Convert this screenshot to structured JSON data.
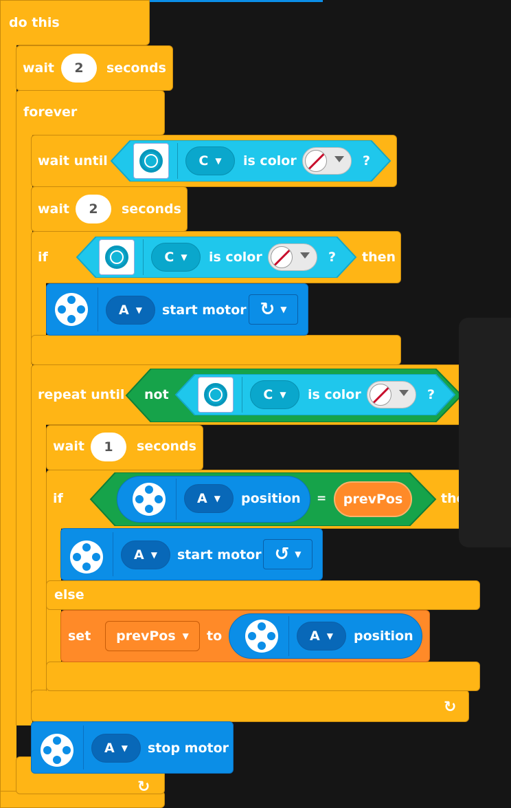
{
  "labels": {
    "do_this": "do this",
    "wait": "wait",
    "seconds": "seconds",
    "forever": "forever",
    "wait_until": "wait until",
    "is_color": "is color",
    "question": "?",
    "if": "if",
    "then": "then",
    "start_motor": "start motor",
    "repeat_until": "repeat until",
    "not": "not",
    "position": "position",
    "equals": "=",
    "else": "else",
    "set": "set",
    "to": "to",
    "stop_motor": "stop motor"
  },
  "values": {
    "wait1": "2",
    "wait2": "2",
    "wait3": "1",
    "port_c": "C",
    "port_a": "A",
    "variable": "prevPos",
    "variable_dropdown": "prevPos"
  },
  "icons": {
    "sensor": "color-sensor-icon",
    "motor": "motor-icon",
    "clockwise": "clockwise-arrow-icon",
    "counterclockwise": "counterclockwise-arrow-icon",
    "no_color": "no-color-icon",
    "loop": "loop-arrow-icon"
  },
  "colors": {
    "control": "#ffb515",
    "motor": "#0b8ee7",
    "sensor": "#1fc7ec",
    "operator": "#16a34a",
    "variable": "#ff8a28",
    "background": "#151515"
  }
}
